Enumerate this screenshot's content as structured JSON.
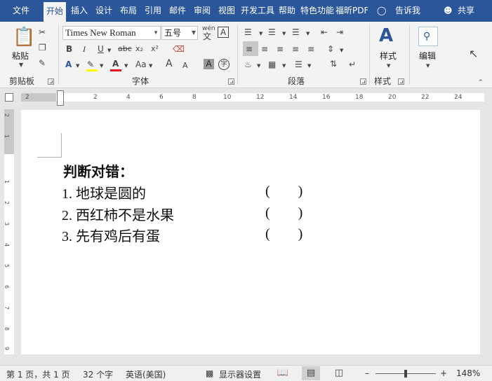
{
  "tabs": [
    "文件",
    "开始",
    "插入",
    "设计",
    "布局",
    "引用",
    "邮件",
    "审阅",
    "视图",
    "开发工具",
    "帮助",
    "特色功能",
    "福昕PDF"
  ],
  "active_tab": "开始",
  "tell_me": "告诉我",
  "share": "共享",
  "clipboard": {
    "paste_label": "粘贴",
    "group_label": "剪贴板"
  },
  "font": {
    "name": "Times New Roman",
    "size": "五号",
    "group_label": "字体",
    "wen_label": "wén",
    "bold": "B",
    "italic": "I",
    "underline": "U",
    "strike": "abc",
    "subscript": "x₂",
    "superscript": "x²",
    "case": "Aa",
    "grow": "A",
    "shrink": "A",
    "char_shade": "A",
    "enclose": "字"
  },
  "paragraph": {
    "group_label": "段落"
  },
  "styles": {
    "label": "样式",
    "group_label": "样式"
  },
  "editing": {
    "label": "编辑"
  },
  "ruler": {
    "numbers": [
      "2",
      "2",
      "4",
      "6",
      "8",
      "10",
      "12",
      "14",
      "16",
      "18",
      "20",
      "22",
      "24"
    ]
  },
  "vruler": {
    "numbers": [
      "2",
      "1",
      "1",
      "2",
      "3",
      "4",
      "5",
      "6",
      "7",
      "8",
      "9"
    ]
  },
  "document": {
    "title": "判断对错：",
    "items": [
      {
        "text": "1.  地球是圆的",
        "blank": "(        )"
      },
      {
        "text": "2.  西红柿不是水果",
        "blank": "(        )"
      },
      {
        "text": "3.  先有鸡后有蛋",
        "blank": "(        )"
      }
    ]
  },
  "status": {
    "page": "第 1 页，共 1 页",
    "words": "32 个字",
    "language": "英语(美国)",
    "display_settings": "显示器设置",
    "zoom": "148%"
  },
  "colors": {
    "accent": "#2b579a",
    "highlight": "#ffff00",
    "font_color": "#e81123"
  }
}
